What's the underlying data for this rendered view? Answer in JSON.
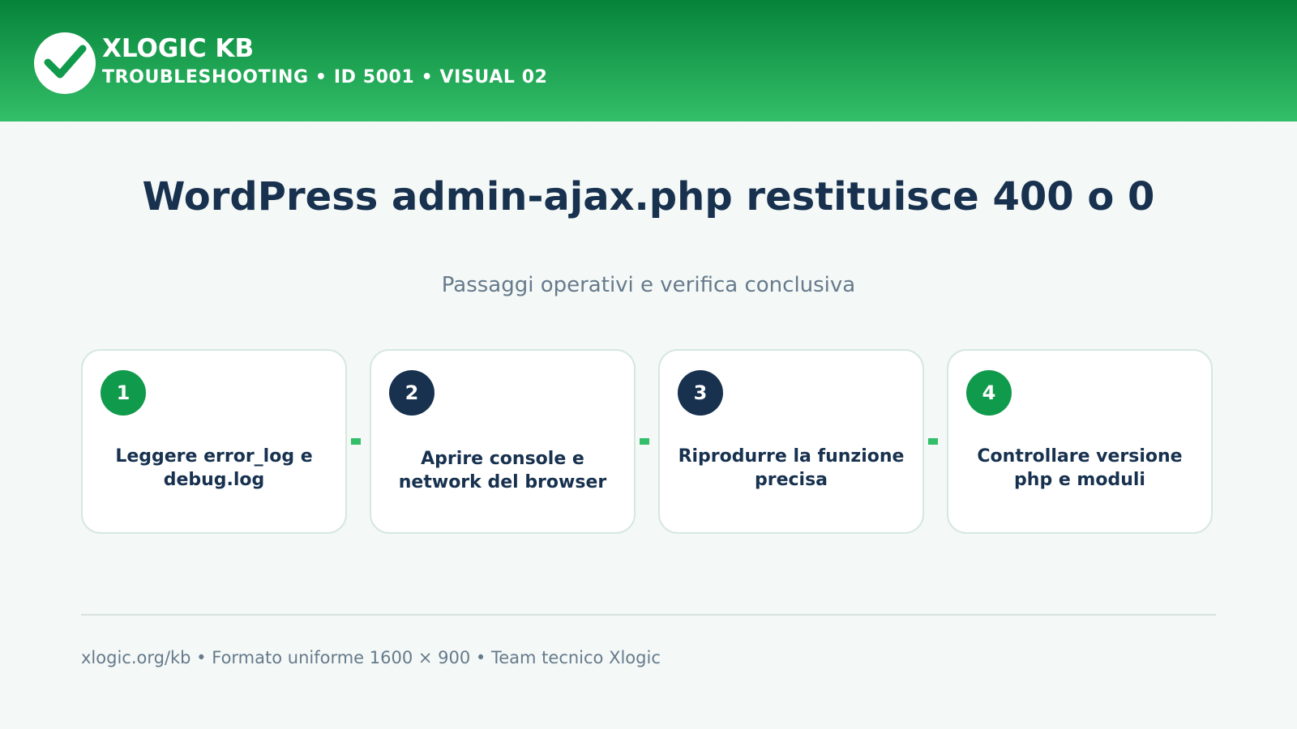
{
  "header": {
    "brand": "XLOGIC KB",
    "subtitle": "TROUBLESHOOTING • ID 5001 • VISUAL 02",
    "logo_icon": "checkmark-icon",
    "colors": {
      "gradient_top": "#06833a",
      "gradient_bottom": "#33bf69"
    }
  },
  "title": "WordPress admin-ajax.php restituisce 400 o 0",
  "subtitle": "Passaggi operativi e verifica conclusiva",
  "steps": [
    {
      "number": "1",
      "text": "Leggere error_log e debug.log",
      "badge_color": "#109a4b"
    },
    {
      "number": "2",
      "text": "Aprire console e network del browser",
      "badge_color": "#17314f"
    },
    {
      "number": "3",
      "text": "Riprodurre la funzione precisa",
      "badge_color": "#17314f"
    },
    {
      "number": "4",
      "text": "Controllare versione php e moduli",
      "badge_color": "#109a4b"
    }
  ],
  "footer": "xlogic.org/kb • Formato uniforme 1600 × 900 • Team tecnico Xlogic",
  "colors": {
    "accent": "#33bf69",
    "text_dark": "#17314f",
    "text_muted": "#667a8c",
    "background": "#f4f8f6"
  }
}
